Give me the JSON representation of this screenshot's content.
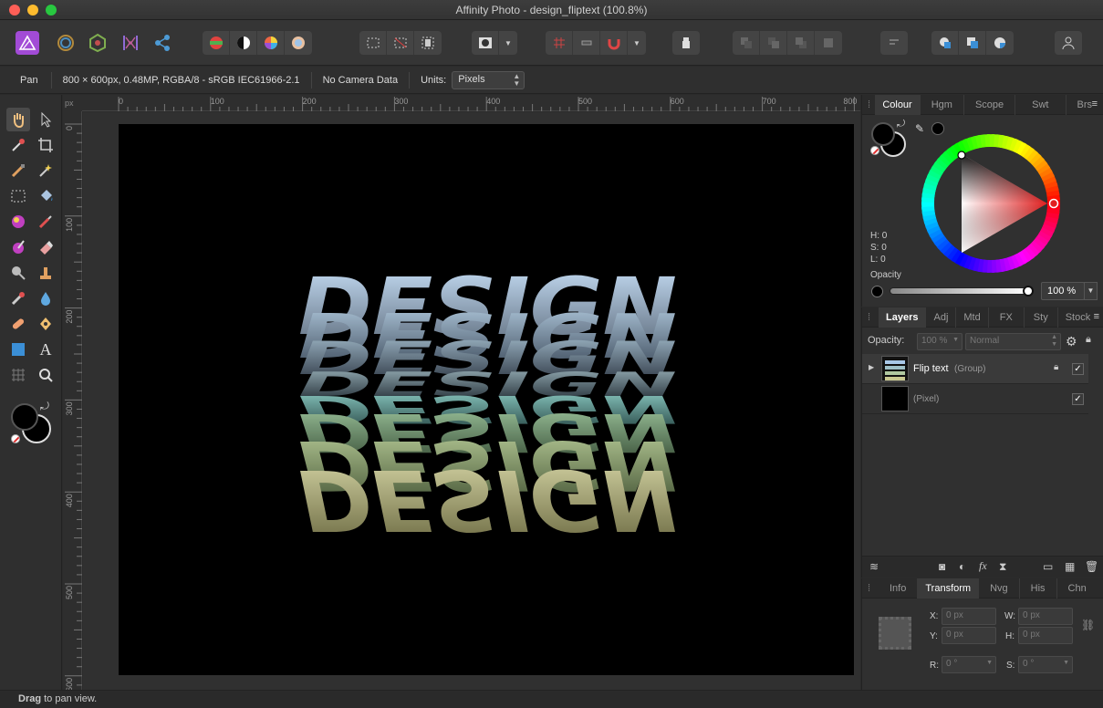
{
  "window": {
    "title": "Affinity Photo - design_fliptext (100.8%)"
  },
  "traffic_colors": {
    "close": "#fe5f57",
    "minimize": "#febc2e",
    "zoom": "#28c840"
  },
  "context": {
    "tool": "Pan",
    "doc_info": "800 × 600px, 0.48MP, RGBA/8 - sRGB IEC61966-2.1",
    "camera": "No Camera Data",
    "units_label": "Units:",
    "units_value": "Pixels"
  },
  "rulers": {
    "unit": "px",
    "top_ticks": [
      "0",
      "100",
      "200",
      "300",
      "400",
      "500",
      "600",
      "700",
      "800"
    ],
    "left_ticks": [
      "0",
      "100",
      "200",
      "300",
      "400",
      "500",
      "600"
    ]
  },
  "canvas": {
    "word": "DESIGN",
    "background": "#000000"
  },
  "colour_panel": {
    "tabs": [
      "Colour",
      "Hgm",
      "Scope",
      "Swt",
      "Brs"
    ],
    "active_tab": "Colour",
    "h": "H: 0",
    "s": "S: 0",
    "l": "L: 0",
    "opacity_label": "Opacity",
    "opacity_value": "100 %"
  },
  "layers_panel": {
    "tabs": [
      "Layers",
      "Adj",
      "Mtd",
      "FX",
      "Sty",
      "Stock"
    ],
    "active_tab": "Layers",
    "opacity_label": "Opacity:",
    "opacity_value": "100 %",
    "blend_mode": "Normal",
    "layers": [
      {
        "name": "Flip text",
        "type": "(Group)"
      },
      {
        "name": "",
        "type": "(Pixel)"
      }
    ]
  },
  "transform_panel": {
    "tabs": [
      "Info",
      "Transform",
      "Nvg",
      "His",
      "Chn"
    ],
    "active_tab": "Transform",
    "x_label": "X:",
    "x_value": "0 px",
    "y_label": "Y:",
    "y_value": "0 px",
    "w_label": "W:",
    "w_value": "0 px",
    "h_label": "H:",
    "h_value": "0 px",
    "r_label": "R:",
    "r_value": "0 °",
    "s_label": "S:",
    "s_value": "0 °"
  },
  "status": {
    "bold": "Drag",
    "rest": " to pan view."
  }
}
